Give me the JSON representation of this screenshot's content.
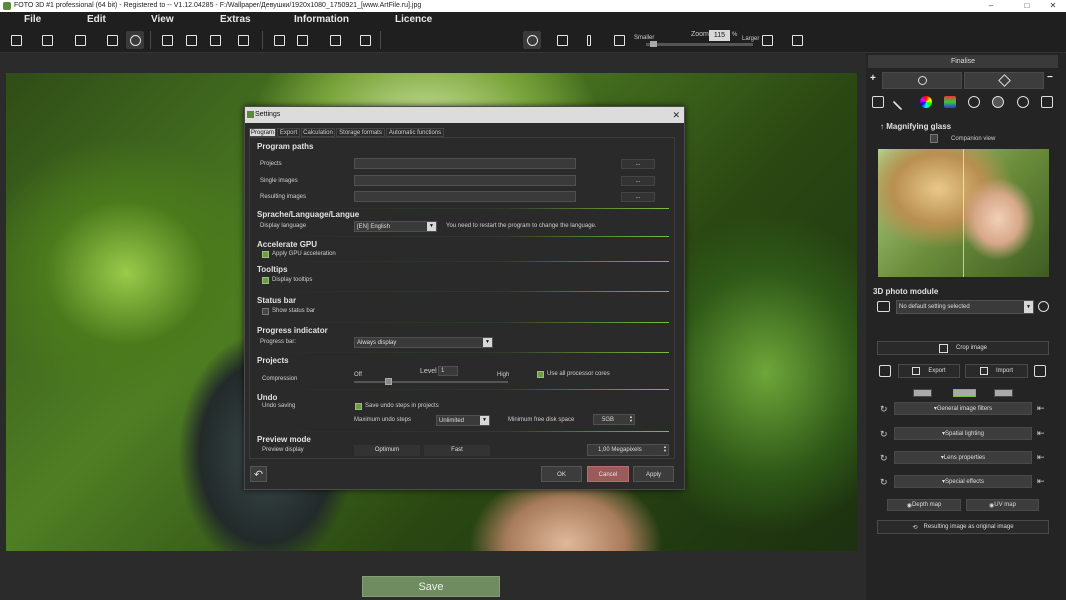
{
  "window": {
    "title": "FOTO 3D #1 professional (64 bit) - Registered to -- V1.12.04285 - F:/Wallpaper/Девушки/1920x1080_1750921_[www.ArtFile.ru].jpg",
    "minimize": "–",
    "maximize": "□",
    "close": "✕"
  },
  "menu": {
    "file": "File",
    "edit": "Edit",
    "view": "View",
    "extras": "Extras",
    "information": "Information",
    "licence": "Licence"
  },
  "toolbar": {
    "smaller": "Smaller",
    "larger": "Larger",
    "zoom_label": "Zoom",
    "zoom_value": "115",
    "zoom_unit": "%"
  },
  "bottom": {
    "save": "Save"
  },
  "right_panel": {
    "finalise": "Finalise",
    "plus": "+",
    "minus": "−",
    "magnifying_glass": "Magnifying glass",
    "companion_view": "Companion view",
    "module_title": "3D photo module",
    "default_setting": "No default setting selected",
    "crop_image": "Crop image",
    "export": "Export",
    "import": "Import",
    "general_filters": "General image filters",
    "spatial_lighting": "Spatial lighting",
    "lens_properties": "Lens properties",
    "special_effects": "Special effects",
    "depth_map": "Depth map",
    "uv_map": "UV map",
    "result_as_original": "Resulting image as original image"
  },
  "dialog": {
    "title": "Settings",
    "close": "✕",
    "tabs": [
      "Program",
      "Export",
      "Calculation",
      "Storage formats",
      "Automatic functions"
    ],
    "program_paths": {
      "heading": "Program paths",
      "projects": "Projects",
      "single_images": "Single images",
      "resulting_images": "Resulting images",
      "browse": "..."
    },
    "language": {
      "heading": "Sprache/Language/Langue",
      "label": "Display language",
      "value": "[EN] English",
      "note": "You need to restart the program to change the language."
    },
    "gpu": {
      "heading": "Accelerate GPU",
      "label": "Apply GPU acceleration"
    },
    "tooltips": {
      "heading": "Tooltips",
      "label": "Display tooltips"
    },
    "status_bar": {
      "heading": "Status bar",
      "label": "Show status bar"
    },
    "progress": {
      "heading": "Progress indicator",
      "label": "Progress bar:",
      "value": "Always display"
    },
    "projects": {
      "heading": "Projects",
      "compression": "Compression",
      "off": "Off",
      "level": "Level",
      "level_value": "1",
      "high": "High",
      "cores": "Use all processor cores"
    },
    "undo": {
      "heading": "Undo",
      "saving": "Undo saving",
      "save_steps": "Save undo steps in projects",
      "max_steps_label": "Maximum undo steps",
      "max_steps_value": "Unlimited",
      "min_disk_label": "Minimum free disk space",
      "min_disk_value": "5GB"
    },
    "preview": {
      "heading": "Preview mode",
      "label": "Preview display",
      "optimum": "Optimum",
      "fast": "Fast",
      "megapixels": "1,00 Megapixels"
    },
    "buttons": {
      "reset": "↶",
      "ok": "OK",
      "cancel": "Cancel",
      "apply": "Apply"
    }
  },
  "colors": {
    "accent_green": "#7bbf3a",
    "save_button": "#6f8c60",
    "cancel_button": "#9a5b5b"
  }
}
